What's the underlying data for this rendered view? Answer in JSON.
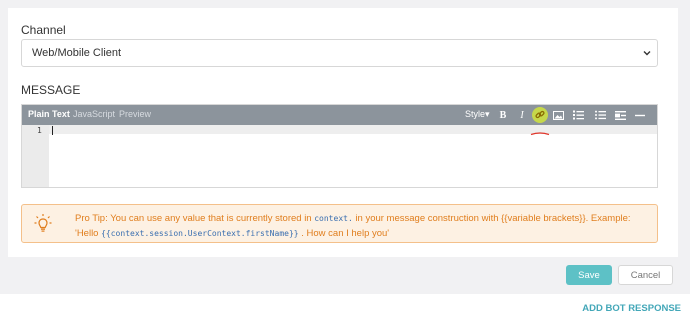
{
  "form": {
    "channel_label": "Channel",
    "channel_value": "Web/Mobile Client",
    "message_label": "MESSAGE"
  },
  "editor": {
    "tabs": [
      {
        "label": "Plain Text",
        "active": true
      },
      {
        "label": "JavaScript",
        "active": false
      },
      {
        "label": "Preview",
        "active": false
      }
    ],
    "style_label": "Style▾",
    "bold_label": "B",
    "italic_label": "I",
    "line_number": "1",
    "toolbar_icons": [
      "bold-icon",
      "italic-icon",
      "link-icon",
      "image-icon",
      "ordered-list-icon",
      "unordered-list-icon",
      "indent-block-icon",
      "horizontal-rule-icon"
    ],
    "highlight_color": "#c6d84a"
  },
  "tip": {
    "part1": "Pro Tip: You can use any value that is currently stored in ",
    "code1": "context.",
    "part2": " in your message construction with {{variable brackets}}. Example: 'Hello ",
    "code2": "{{context.session.UserContext.firstName}}",
    "part3": " . How can I help you'",
    "icon": "lightbulb-icon",
    "accent_color": "#e07e1e"
  },
  "actions": {
    "save_label": "Save",
    "cancel_label": "Cancel",
    "save_color": "#5dc1c6"
  },
  "footer": {
    "add_bot_label": "ADD BOT RESPONSE",
    "link_color": "#43a7b8"
  }
}
